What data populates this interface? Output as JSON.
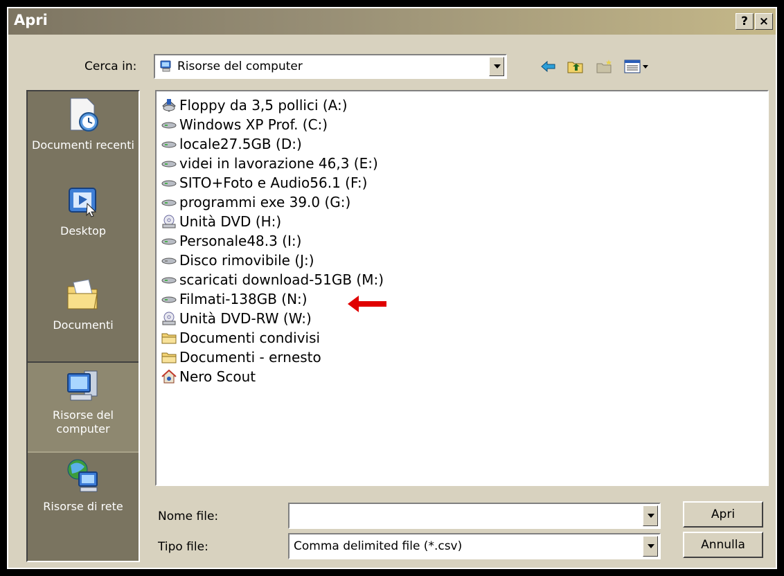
{
  "window": {
    "title": "Apri",
    "help_button": "?",
    "close_button": "×"
  },
  "look_in": {
    "label": "Cerca in:",
    "value": "Risorse del computer",
    "icon": "my-computer-icon"
  },
  "toolbar": {
    "back": "back-arrow-icon",
    "up": "up-folder-icon",
    "new_folder": "new-folder-icon",
    "views": "view-menu-icon"
  },
  "places": [
    {
      "label": "Documenti recenti",
      "icon": "recent-documents-icon"
    },
    {
      "label": "Desktop",
      "icon": "desktop-icon"
    },
    {
      "label": "Documenti",
      "icon": "documents-folder-icon"
    },
    {
      "label": "Risorse del computer",
      "icon": "my-computer-icon",
      "selected": true
    },
    {
      "label": "Risorse di rete",
      "icon": "network-icon"
    }
  ],
  "files": [
    {
      "name": "Floppy da 3,5 pollici (A:)",
      "icon": "floppy-drive-icon"
    },
    {
      "name": "Windows XP Prof. (C:)",
      "icon": "hard-drive-icon"
    },
    {
      "name": "locale27.5GB (D:)",
      "icon": "hard-drive-icon"
    },
    {
      "name": " videi in lavorazione 46,3 (E:)",
      "icon": "hard-drive-icon"
    },
    {
      "name": "SITO+Foto e Audio56.1 (F:)",
      "icon": "hard-drive-icon"
    },
    {
      "name": "programmi exe 39.0 (G:)",
      "icon": "hard-drive-icon"
    },
    {
      "name": "Unità DVD (H:)",
      "icon": "dvd-drive-icon"
    },
    {
      "name": "Personale48.3 (I:)",
      "icon": "hard-drive-icon"
    },
    {
      "name": "Disco rimovibile (J:)",
      "icon": "removable-disk-icon"
    },
    {
      "name": "scaricati download-51GB (M:)",
      "icon": "hard-drive-icon"
    },
    {
      "name": "Filmati-138GB (N:)",
      "icon": "hard-drive-icon"
    },
    {
      "name": "Unità DVD-RW (W:)",
      "icon": "dvd-drive-icon"
    },
    {
      "name": "Documenti condivisi",
      "icon": "folder-icon"
    },
    {
      "name": "Documenti - ernesto",
      "icon": "folder-icon"
    },
    {
      "name": "Nero Scout",
      "icon": "nero-scout-icon"
    }
  ],
  "annotation": {
    "icon": "red-arrow-icon",
    "color": "#e00000"
  },
  "filename": {
    "label": "Nome file:",
    "value": ""
  },
  "filetype": {
    "label": "Tipo file:",
    "value": "Comma delimited file (*.csv)"
  },
  "buttons": {
    "open": "Apri",
    "cancel": "Annulla"
  }
}
